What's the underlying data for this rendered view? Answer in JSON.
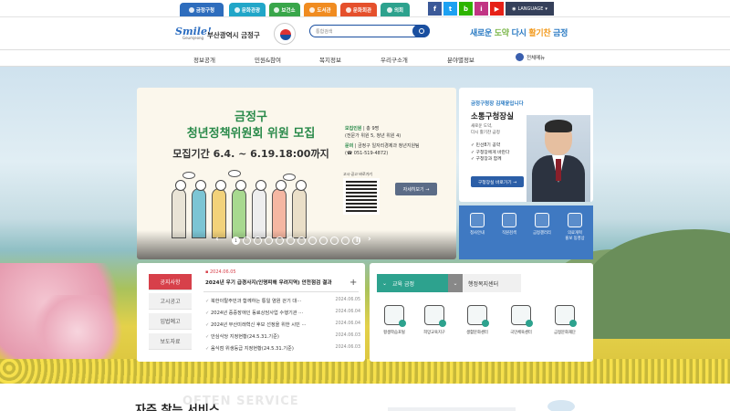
{
  "topbar": {
    "tabs": [
      {
        "label": "금정구청",
        "color": "#2e6dbd"
      },
      {
        "label": "문화관광",
        "color": "#21a6c8"
      },
      {
        "label": "보건소",
        "color": "#39a64a"
      },
      {
        "label": "도서관",
        "color": "#f08c21"
      },
      {
        "label": "문화회관",
        "color": "#e5502c"
      },
      {
        "label": "의회",
        "color": "#2da28e"
      }
    ],
    "social": [
      "f",
      "t",
      "b",
      "i",
      "▶"
    ],
    "language": "LANGUAGE"
  },
  "header": {
    "logo_word": "Smile!",
    "logo_sub": "Geumjeong",
    "district": "부산광역시 금정구",
    "search_placeholder": "통합검색",
    "slogan": {
      "a": "새로운 ",
      "b": "도약",
      "c": " 다시 ",
      "d": "활기찬",
      "e": " 금정"
    }
  },
  "nav": {
    "items": [
      "정보공개",
      "민원&참여",
      "복지정보",
      "우리구소개",
      "분야별정보"
    ],
    "all_menu": "전체메뉴"
  },
  "banner": {
    "title_line1": "금정구",
    "title_line2": "청년정책위원회 위원 모집",
    "period": "모집기간 6.4. ~ 6.19.18:00까지",
    "info_label1": "모집인원",
    "info_val1": "총 9명",
    "info_val1b": "(전문가 위원 5, 청년 위원 4)",
    "info_label2": "문의",
    "info_val2": "금정구 일자리경제과 청년지원팀",
    "info_val2b": "(☎ 051-519-4872)",
    "qr_label": "고시·공고 바로가기",
    "more": "자세히보기 →",
    "pager": {
      "current": "1",
      "count": 12,
      "prev": "‹",
      "next": "›",
      "pause": "II"
    }
  },
  "mayor": {
    "subtitle": "금정구청장 김재윤입니다",
    "title": "소통구청장실",
    "desc1": "새로운 도약,",
    "desc2": "다시 활기찬 금정",
    "links": [
      "민선8기 공약",
      "구청장에게 바란다",
      "구청장과 함께"
    ],
    "button": "구청장실 바로가기 →"
  },
  "quick_menu": [
    "청사안내",
    "직원검색",
    "금정갤러리",
    "의료개혁\n홍보 동영상"
  ],
  "notice": {
    "tabs": [
      "공지사항",
      "고시공고",
      "입법예고",
      "보도자료"
    ],
    "highlight_date": "2024.06.05",
    "headline": "2024년 우기 급경사지(인명피해 우려지역) 안전점검 결과",
    "plus": "+",
    "rows": [
      {
        "title": "북한이탈주민과 함께하는 통일 염원 걷기 대···",
        "date": "2024.06.05"
      },
      {
        "title": "2024년 중증장애인 동료상담사업 수행기관 ···",
        "date": "2024.06.04"
      },
      {
        "title": "2024년 부산미래혁신 후보 선정을 위한 시민 ···",
        "date": "2024.06.04"
      },
      {
        "title": "안심식당 지정현황(24.5.31.기준)",
        "date": "2024.06.03"
      },
      {
        "title": "음식점 위생등급 지정현황(24.5.31.기준)",
        "date": "2024.06.03"
      }
    ]
  },
  "education": {
    "tab_active": "교육 금정",
    "tab_other": "행정복지센터",
    "items": [
      "평생학습포털",
      "희망교육지구",
      "생활문화센터",
      "국민체육센터",
      "금정문화재단"
    ]
  },
  "bottom": {
    "title": "자주 찾는 서비스",
    "watermark": "OFTEN SERVICE"
  }
}
